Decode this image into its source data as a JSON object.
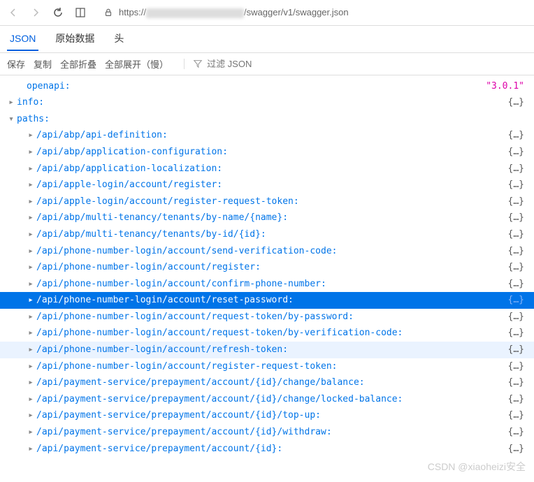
{
  "browser": {
    "url_prefix": "https://",
    "url_suffix": "/swagger/v1/swagger.json"
  },
  "tabs": [
    {
      "label": "JSON",
      "active": true
    },
    {
      "label": "原始数据",
      "active": false
    },
    {
      "label": "头",
      "active": false
    }
  ],
  "toolbar": {
    "save": "保存",
    "copy": "复制",
    "collapse_all": "全部折叠",
    "expand_all": "全部展开（慢）",
    "filter_placeholder": "过滤 JSON"
  },
  "tree": {
    "openapi_key": "openapi:",
    "openapi_value": "\"3.0.1\"",
    "info_key": "info:",
    "paths_key": "paths:",
    "paths": [
      {
        "key": "/api/abp/api-definition:",
        "selected": false,
        "hl": false
      },
      {
        "key": "/api/abp/application-configuration:",
        "selected": false,
        "hl": false
      },
      {
        "key": "/api/abp/application-localization:",
        "selected": false,
        "hl": false
      },
      {
        "key": "/api/apple-login/account/register:",
        "selected": false,
        "hl": false
      },
      {
        "key": "/api/apple-login/account/register-request-token:",
        "selected": false,
        "hl": false
      },
      {
        "key": "/api/abp/multi-tenancy/tenants/by-name/{name}:",
        "selected": false,
        "hl": false
      },
      {
        "key": "/api/abp/multi-tenancy/tenants/by-id/{id}:",
        "selected": false,
        "hl": false
      },
      {
        "key": "/api/phone-number-login/account/send-verification-code:",
        "selected": false,
        "hl": false
      },
      {
        "key": "/api/phone-number-login/account/register:",
        "selected": false,
        "hl": false
      },
      {
        "key": "/api/phone-number-login/account/confirm-phone-number:",
        "selected": false,
        "hl": false
      },
      {
        "key": "/api/phone-number-login/account/reset-password:",
        "selected": true,
        "hl": false
      },
      {
        "key": "/api/phone-number-login/account/request-token/by-password:",
        "selected": false,
        "hl": false
      },
      {
        "key": "/api/phone-number-login/account/request-token/by-verification-code:",
        "selected": false,
        "hl": false
      },
      {
        "key": "/api/phone-number-login/account/refresh-token:",
        "selected": false,
        "hl": true
      },
      {
        "key": "/api/phone-number-login/account/register-request-token:",
        "selected": false,
        "hl": false
      },
      {
        "key": "/api/payment-service/prepayment/account/{id}/change/balance:",
        "selected": false,
        "hl": false
      },
      {
        "key": "/api/payment-service/prepayment/account/{id}/change/locked-balance:",
        "selected": false,
        "hl": false
      },
      {
        "key": "/api/payment-service/prepayment/account/{id}/top-up:",
        "selected": false,
        "hl": false
      },
      {
        "key": "/api/payment-service/prepayment/account/{id}/withdraw:",
        "selected": false,
        "hl": false
      },
      {
        "key": "/api/payment-service/prepayment/account/{id}:",
        "selected": false,
        "hl": false
      }
    ],
    "collapse_value": "{…}"
  },
  "watermark": "CSDN @xiaoheizi安全"
}
